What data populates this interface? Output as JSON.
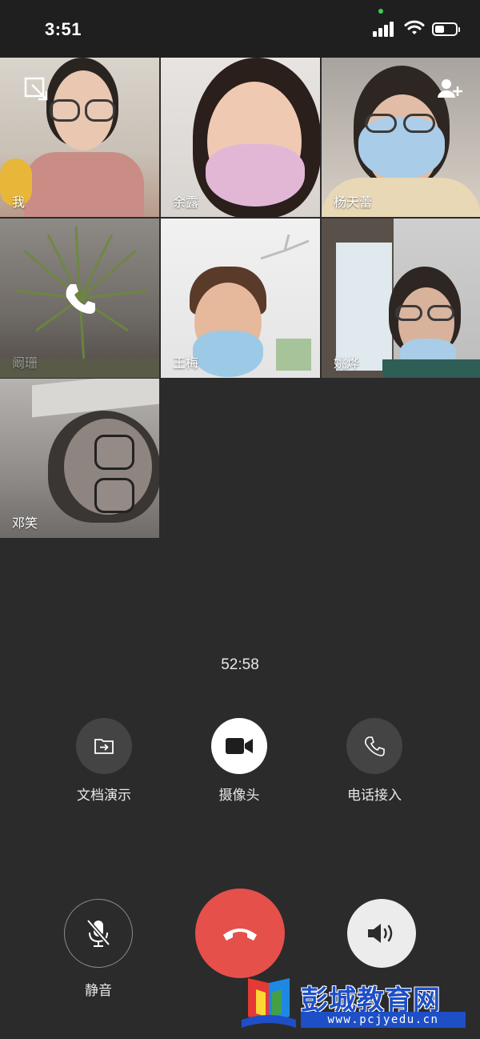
{
  "status_bar": {
    "time": "3:51",
    "camera_indicator_color": "#3ecf4e",
    "icons": [
      "signal-icon",
      "wifi-icon",
      "battery-icon"
    ]
  },
  "participants": [
    {
      "name": "我",
      "state": "video"
    },
    {
      "name": "余露",
      "state": "video"
    },
    {
      "name": "杨天蕾",
      "state": "video"
    },
    {
      "name": "阚珊",
      "state": "calling"
    },
    {
      "name": "王梅",
      "state": "video"
    },
    {
      "name": "姚烨",
      "state": "video"
    },
    {
      "name": "邓笑",
      "state": "video"
    }
  ],
  "overlay_icons": {
    "minimize": "minimize-window-icon",
    "add_member": "add-member-icon"
  },
  "call": {
    "duration": "52:58"
  },
  "actions": [
    {
      "label": "文档演示",
      "icon": "document-share-icon"
    },
    {
      "label": "摄像头",
      "icon": "video-camera-icon"
    },
    {
      "label": "电话接入",
      "icon": "phone-icon"
    }
  ],
  "controls": {
    "mute_label": "静音",
    "mute_icon": "microphone-off-icon",
    "hangup_icon": "hang-up-icon",
    "speaker_icon": "speaker-icon",
    "hangup_color": "#e5504b"
  },
  "watermark": {
    "title": "彭城教育网",
    "url": "www.pcjyedu.cn"
  },
  "colors": {
    "background": "#2b2b2b",
    "button_gray": "#444444",
    "watermark_blue": "#1e4fc7"
  }
}
